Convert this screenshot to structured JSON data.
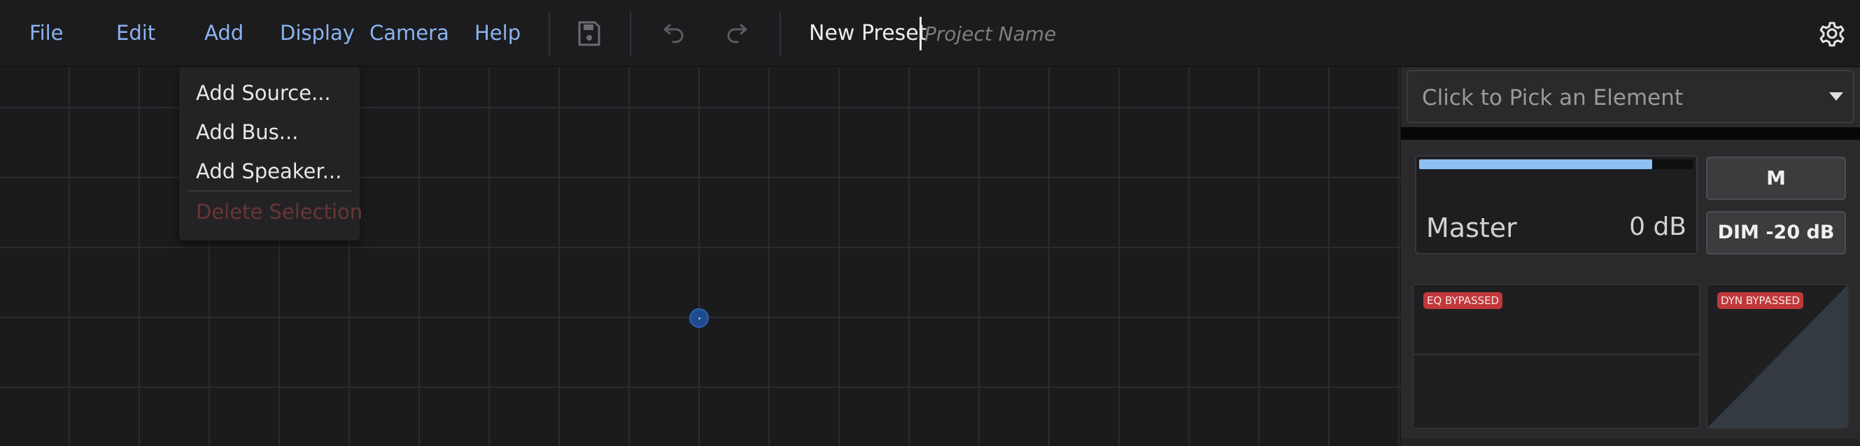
{
  "menubar": {
    "menus": [
      "File",
      "Edit",
      "Add",
      "Display",
      "Camera",
      "Help"
    ]
  },
  "toolbar": {
    "icons": [
      "save-icon",
      "undo-icon",
      "redo-icon",
      "settings-gear-icon"
    ]
  },
  "project": {
    "preset_name": "New Preset",
    "project_name_value": "",
    "project_name_placeholder": "Project Name"
  },
  "add_menu": {
    "items": [
      "Add Source...",
      "Add Bus...",
      "Add Speaker..."
    ],
    "delete_label": "Delete Selection"
  },
  "panel": {
    "element_picker_text": "Click to Pick an Element",
    "master_label": "Master",
    "master_level_db": "0 dB",
    "level_meter_fraction": 0.85,
    "mute_label": "M",
    "dim_label": "DIM -20 dB",
    "eq_badge": "EQ BYPASSED",
    "dyn_badge": "DYN BYPASSED"
  },
  "colors": {
    "accent_blue": "#8ab4f0",
    "meter_fill": "#8ec1f2",
    "bypass_badge": "#c0383a",
    "listener_dot": "#1f4b8c",
    "disabled_red": "#6b3434"
  }
}
